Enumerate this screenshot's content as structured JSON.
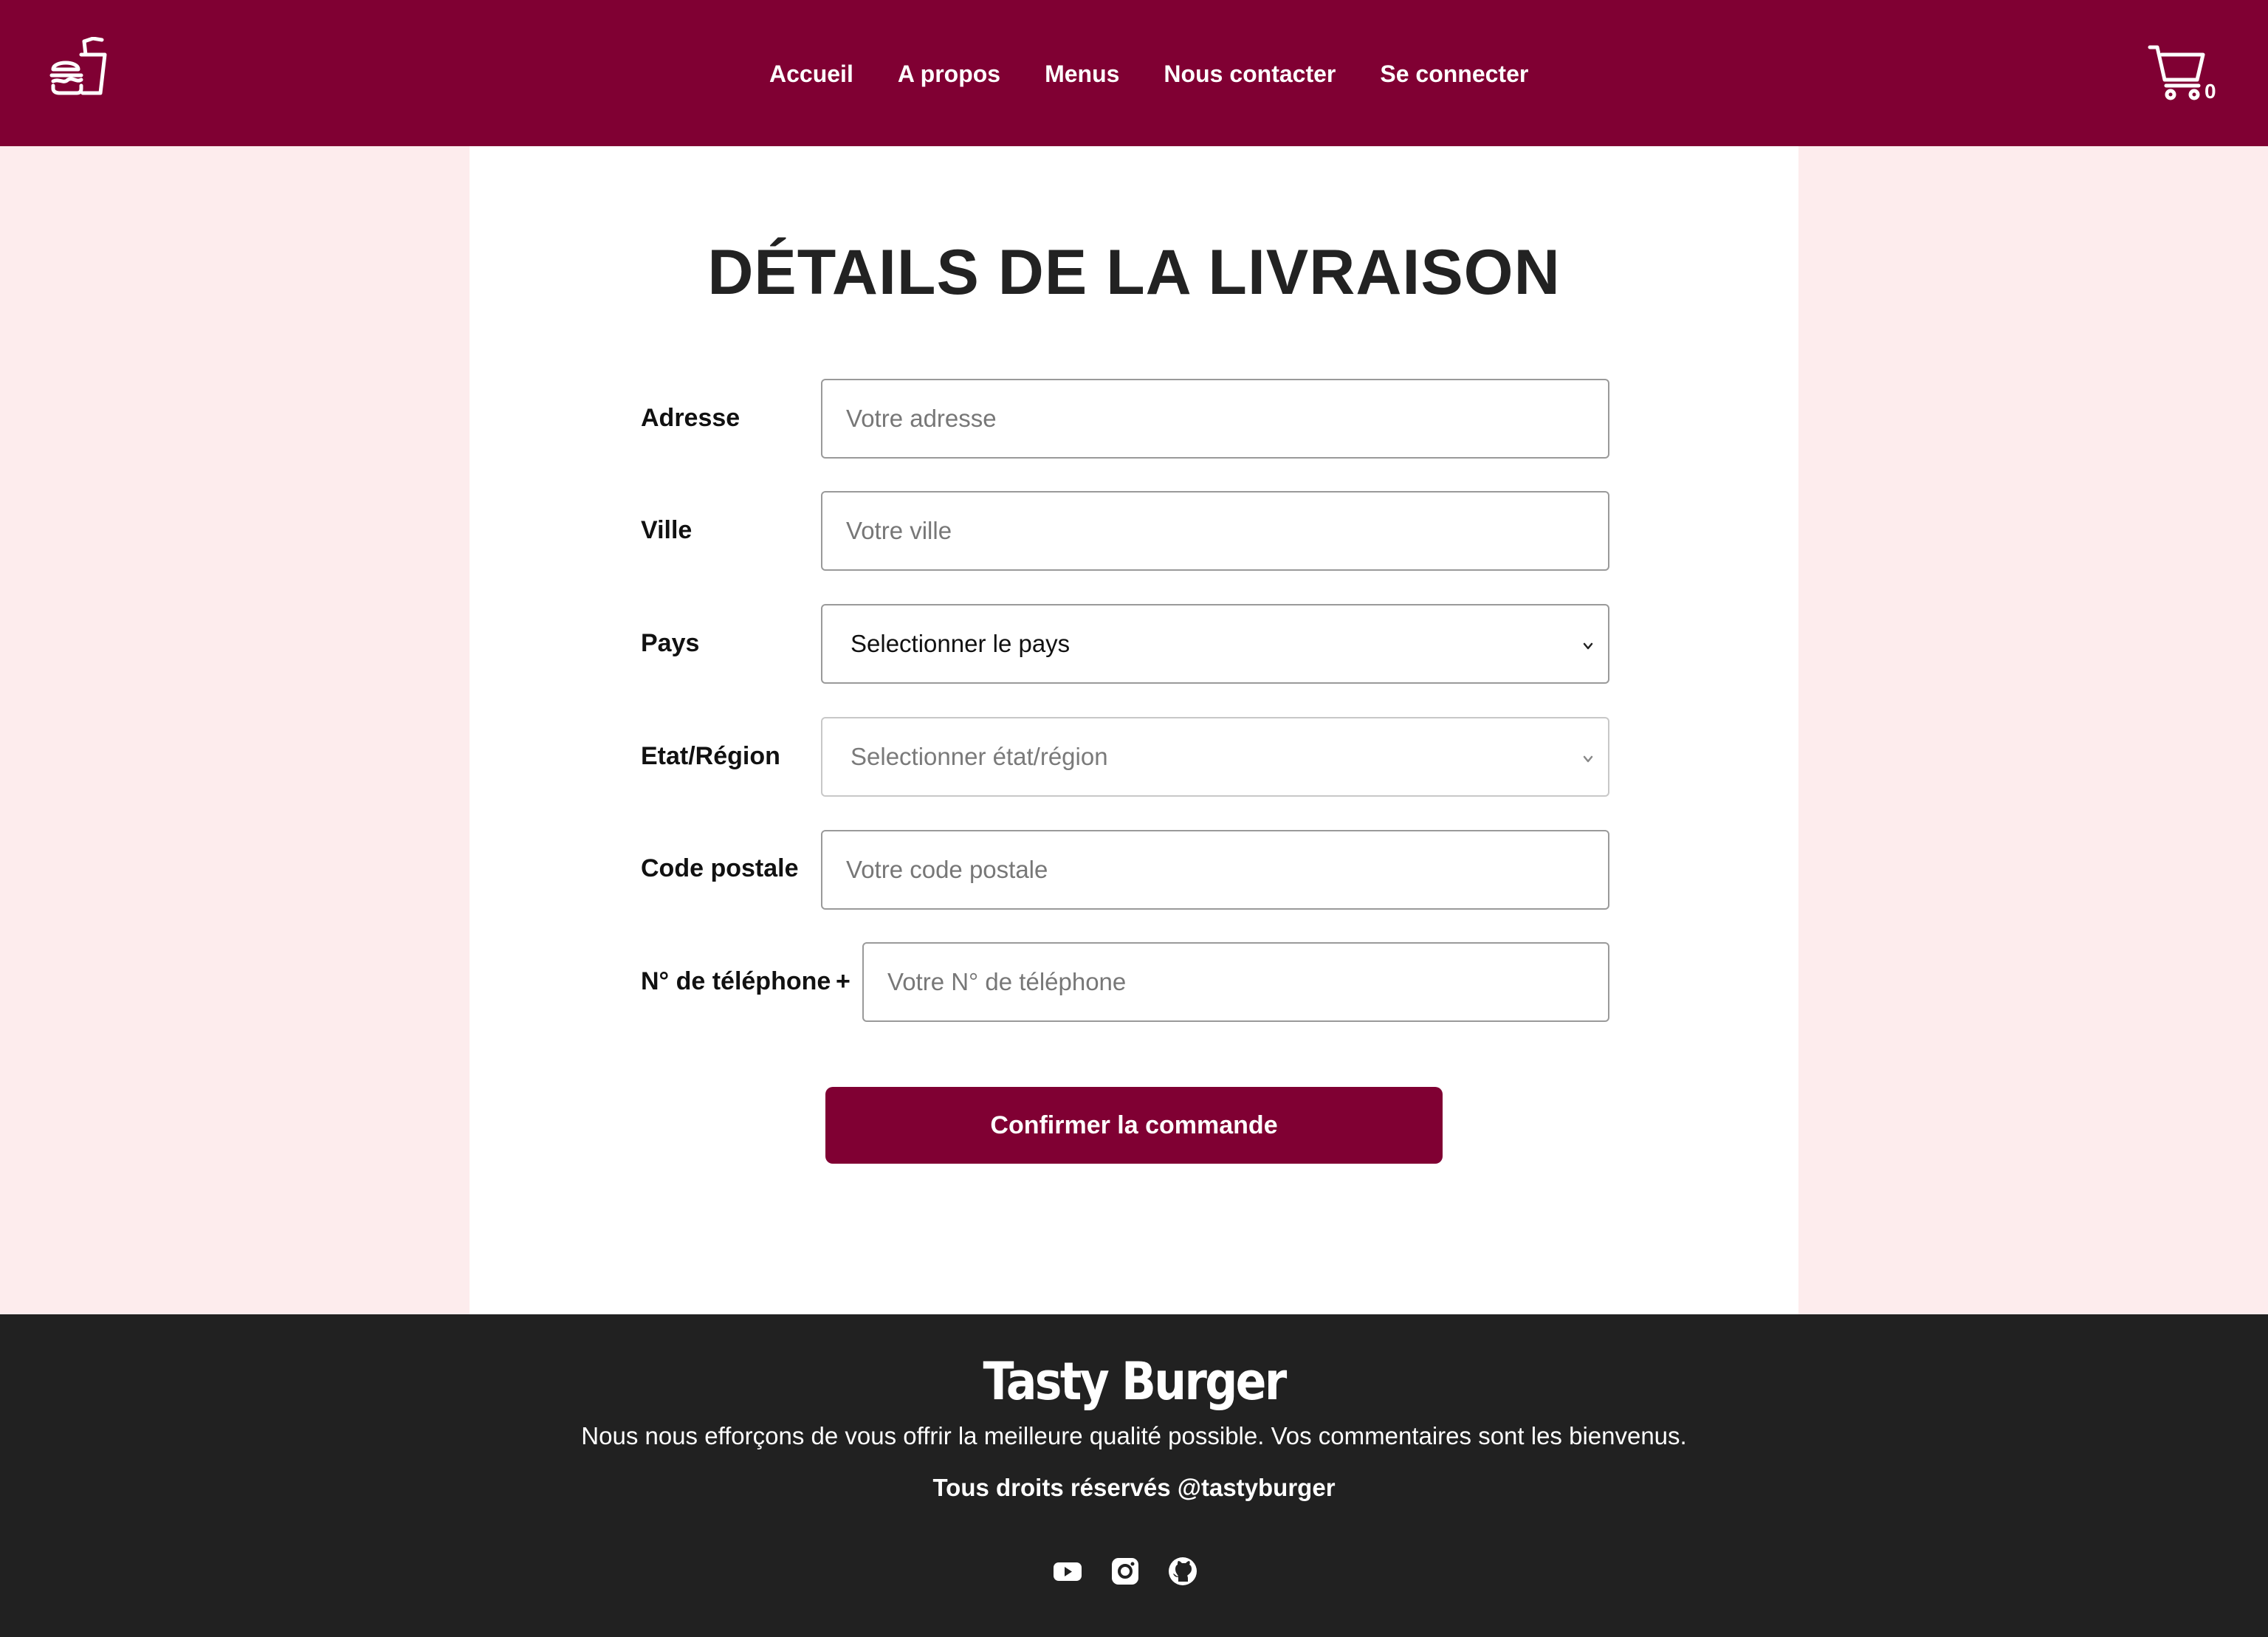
{
  "header": {
    "logo_icon": "burger-drink-icon",
    "nav": [
      {
        "label": "Accueil"
      },
      {
        "label": "A propos"
      },
      {
        "label": "Menus"
      },
      {
        "label": "Nous contacter"
      },
      {
        "label": "Se connecter"
      }
    ],
    "cart_icon": "cart-icon",
    "cart_count": "0"
  },
  "form": {
    "title": "DÉTAILS DE LA LIVRAISON",
    "address": {
      "label": "Adresse",
      "placeholder": "Votre adresse"
    },
    "city": {
      "label": "Ville",
      "placeholder": "Votre ville"
    },
    "country": {
      "label": "Pays",
      "value": "Selectionner le pays"
    },
    "region": {
      "label": "Etat/Région",
      "value": "Selectionner état/région"
    },
    "postal": {
      "label": "Code postale",
      "placeholder": "Votre code postale"
    },
    "phone": {
      "label": "N° de téléphone",
      "prefix": "+",
      "placeholder": "Votre N° de téléphone"
    },
    "submit_label": "Confirmer la commande"
  },
  "footer": {
    "brand": "Tasty Burger",
    "tagline": "Nous nous efforçons de vous offrir la meilleure qualité possible. Vos commentaires sont les bienvenus.",
    "rights": "Tous droits réservés @tastyburger",
    "socials": [
      "youtube-icon",
      "instagram-icon",
      "github-icon"
    ]
  },
  "colors": {
    "brand": "#800033",
    "page_bg": "#fdeced",
    "footer_bg": "#212121"
  }
}
